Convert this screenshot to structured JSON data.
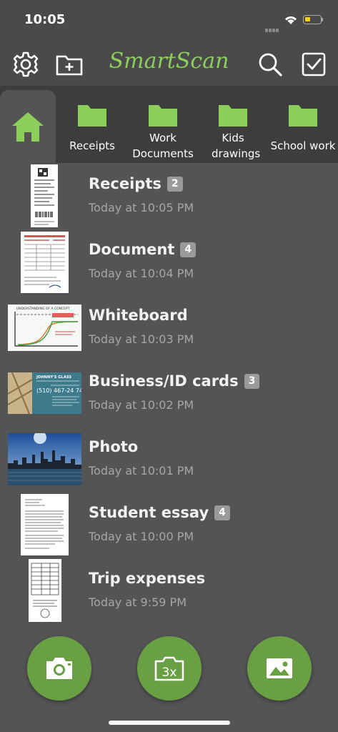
{
  "status": {
    "time": "10:05"
  },
  "header": {
    "app_name": "SmartScan"
  },
  "icons": {
    "settings": "gear-icon",
    "new_folder": "folder-plus-icon",
    "search": "search-icon",
    "select": "checkbox-icon",
    "home": "home-icon",
    "camera": "camera-icon",
    "batch_camera": "camera-3x-icon",
    "gallery": "image-icon"
  },
  "colors": {
    "accent": "#8ccf5b",
    "fab": "#6aa044",
    "background": "#545454",
    "bar": "#4a4a4a"
  },
  "folders": [
    {
      "label": "Receipts"
    },
    {
      "label": "Work Documents"
    },
    {
      "label": "Kids drawings"
    },
    {
      "label": "School work"
    }
  ],
  "documents": [
    {
      "title": "Receipts",
      "count": "2",
      "time": "Today at 10:05 PM"
    },
    {
      "title": "Document",
      "count": "4",
      "time": "Today at 10:04 PM"
    },
    {
      "title": "Whiteboard",
      "count": "",
      "time": "Today at 10:03 PM"
    },
    {
      "title": "Business/ID cards",
      "count": "3",
      "time": "Today at 10:02 PM"
    },
    {
      "title": "Photo",
      "count": "",
      "time": "Today at 10:01 PM"
    },
    {
      "title": "Student essay",
      "count": "4",
      "time": "Today at 10:00 PM"
    },
    {
      "title": "Trip expenses",
      "count": "",
      "time": "Today at 9:59 PM"
    }
  ],
  "fab": {
    "batch_label": "3x"
  },
  "thumbnail_text": {
    "whiteboard_title": "UNDERSTANDING OF A CONCEPT",
    "card_name": "JOHNNY'S GLASS",
    "card_phone": "(510) 467-24 74"
  }
}
